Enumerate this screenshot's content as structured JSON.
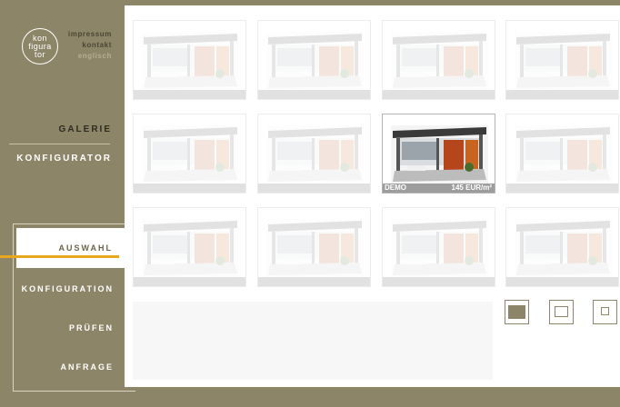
{
  "logo": {
    "lines": [
      "kon",
      "figura",
      "tor"
    ]
  },
  "top_links": [
    "impressum",
    "kontakt",
    "englisch"
  ],
  "nav": {
    "galerie": "GALERIE",
    "konfigurator": "KONFIGURATOR"
  },
  "steps": [
    "AUSWAHL",
    "KONFIGURATION",
    "PRÜFEN",
    "ANFRAGE"
  ],
  "gallery": {
    "active_index": 6,
    "active_caption_left": "DEMO",
    "active_caption_right": "145 EUR/m²"
  },
  "colors": {
    "brand": "#8d8568",
    "accent": "#e8a81e"
  }
}
